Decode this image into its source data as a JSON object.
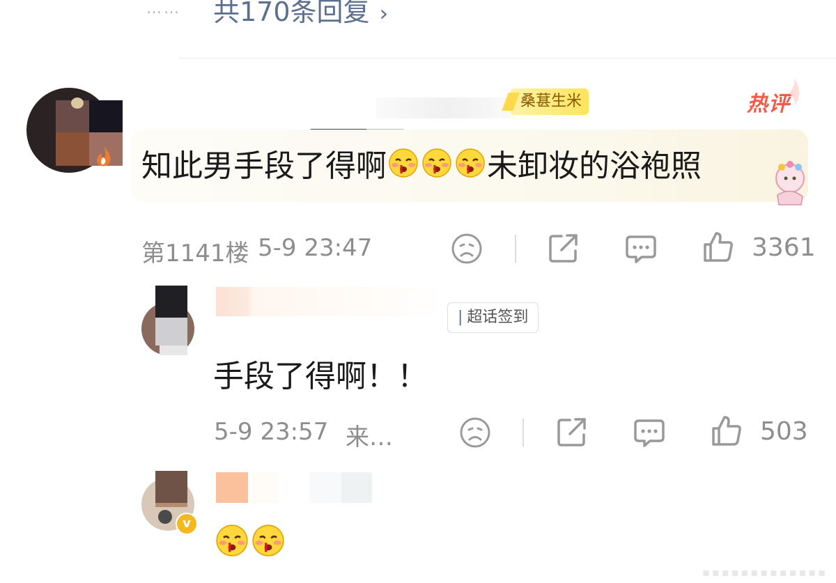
{
  "reply_summary": {
    "dots": "……",
    "label": "共170条回复",
    "chevron": "chevron-right-icon"
  },
  "main_comment": {
    "medal": "桑葚生米",
    "hot_badge": "热评",
    "text_before": "知此男手段了得啊",
    "emoji_count": 3,
    "emoji": "blushing-nosebleed-emoji",
    "text_after": "未卸妆的浴袍照",
    "floor": "第1141楼",
    "time": "5-9 23:47",
    "likes": "3361"
  },
  "reply_1": {
    "tag": "超话签到",
    "text": "手段了得啊！！",
    "time": "5-9 23:57",
    "source": "来…",
    "likes": "503"
  },
  "reply_2": {
    "verified_mark": "v",
    "emoji_count": 2
  },
  "actions": {
    "dislike_icon": "frown-face-icon",
    "share_icon": "share-icon",
    "comment_icon": "comment-bubble-icon",
    "like_icon": "thumbs-up-icon"
  },
  "colors": {
    "link": "#5d6f8e",
    "meta_gray": "#8d8d8d",
    "hot_red": "#f25a4a",
    "medal_yellow": "#ffe45c"
  }
}
